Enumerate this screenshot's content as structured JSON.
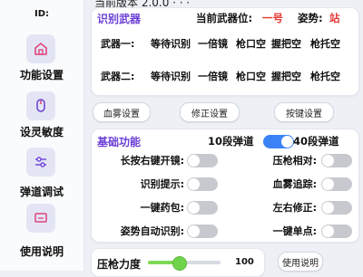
{
  "sidebar": {
    "id_label": "ID:",
    "items": [
      {
        "label": "功能设置",
        "icon": "home-icon"
      },
      {
        "label": "设灵敏度",
        "icon": "mouse-icon"
      },
      {
        "label": "弹道调试",
        "icon": "sliders-icon"
      },
      {
        "label": "使用说明",
        "icon": "monitor-icon"
      }
    ]
  },
  "top_partial_text": "当前版本  2.0.0  ·  ·  ·",
  "weapon": {
    "title": "识别武器",
    "current_slot_label": "当前武器位:",
    "current_slot_value": "一号",
    "stance_label": "姿势:",
    "stance_value": "站",
    "rows": [
      {
        "name": "武器一:",
        "cells": [
          "等待识别",
          "一倍镜",
          "枪口空",
          "握把空",
          "枪托空"
        ]
      },
      {
        "name": "武器二:",
        "cells": [
          "等待识别",
          "一倍镜",
          "枪口空",
          "握把空",
          "枪托空"
        ]
      }
    ]
  },
  "buttons": {
    "blood_fog": "血雾设置",
    "correction": "修正设置",
    "keybind": "按键设置",
    "manual": "使用说明"
  },
  "basic": {
    "title": "基础功能",
    "mode_left": "10段弹道",
    "mode_right": "40段弹道",
    "mode_toggle_on": true,
    "left_toggles": [
      {
        "label": "长按右键开镜:",
        "on": false
      },
      {
        "label": "识别提示:",
        "on": false
      },
      {
        "label": "一键药包:",
        "on": false
      },
      {
        "label": "姿势自动识别:",
        "on": false
      }
    ],
    "right_toggles": [
      {
        "label": "压枪相对:",
        "on": false
      },
      {
        "label": "血雾追踪:",
        "on": false
      },
      {
        "label": "左右修正:",
        "on": false
      },
      {
        "label": "一键单点:",
        "on": false
      }
    ]
  },
  "pressure": {
    "label": "压枪力度",
    "value": "100",
    "fraction": 0.42
  }
}
